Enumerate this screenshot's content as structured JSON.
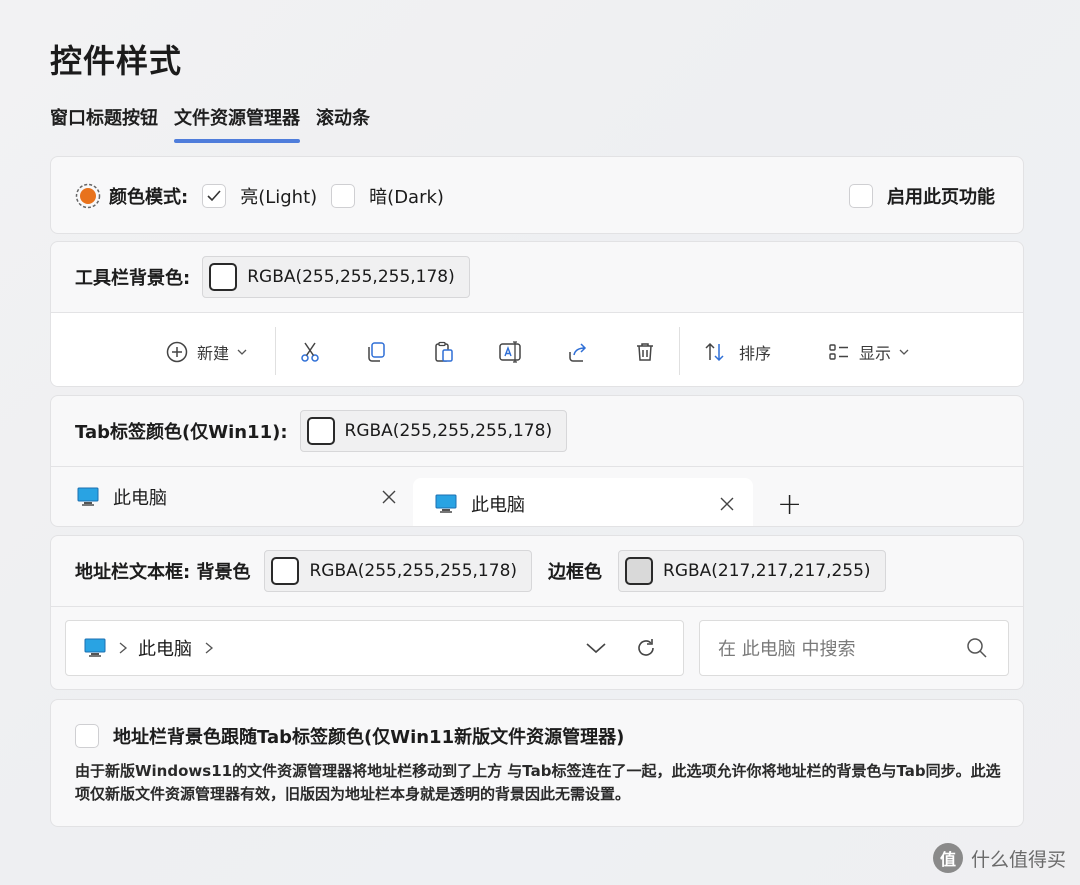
{
  "page": {
    "title": "控件样式"
  },
  "tabs": [
    {
      "label": "窗口标题按钮"
    },
    {
      "label": "文件资源管理器",
      "active": true
    },
    {
      "label": "滚动条"
    }
  ],
  "colors": {
    "accent": "#4f7ddb",
    "radio_orange": "#e8721c",
    "swatch_gray": "#d9d9d9"
  },
  "color_mode": {
    "label": "颜色模式:",
    "light_label": "亮(Light)",
    "light_checked": true,
    "dark_label": "暗(Dark)",
    "dark_checked": false,
    "enable_label": "启用此页功能",
    "enable_checked": false
  },
  "toolbar_bg": {
    "label": "工具栏背景色:",
    "value": "RGBA(255,255,255,178)",
    "buttons": {
      "new_label": "新建",
      "sort_label": "排序",
      "view_label": "显示"
    },
    "icons": [
      "plus-circle-icon",
      "chevron-down-icon",
      "cut-icon",
      "copy-icon",
      "paste-icon",
      "rename-icon",
      "share-icon",
      "delete-icon",
      "sort-icon",
      "view-icon",
      "chevron-down-icon"
    ]
  },
  "tab_color": {
    "label": "Tab标签颜色(仅Win11):",
    "value": "RGBA(255,255,255,178)",
    "tab1_label": "此电脑",
    "tab2_label": "此电脑",
    "add_label": "+"
  },
  "address_bar": {
    "label": "地址栏文本框: 背景色",
    "bg_value": "RGBA(255,255,255,178)",
    "border_label": "边框色",
    "border_value": "RGBA(217,217,217,255)",
    "path_label": "此电脑",
    "search_placeholder": "在 此电脑 中搜索"
  },
  "follow_tab": {
    "label": "地址栏背景色跟随Tab标签颜色(仅Win11新版文件资源管理器)",
    "checked": false,
    "description": "由于新版Windows11的文件资源管理器将地址栏移动到了上方 与Tab标签连在了一起，此选项允许你将地址栏的背景色与Tab同步。此选项仅新版文件资源管理器有效，旧版因为地址栏本身就是透明的背景因此无需设置。"
  },
  "footer": {
    "watermark": "什么值得买",
    "logo_glyph": "值"
  }
}
